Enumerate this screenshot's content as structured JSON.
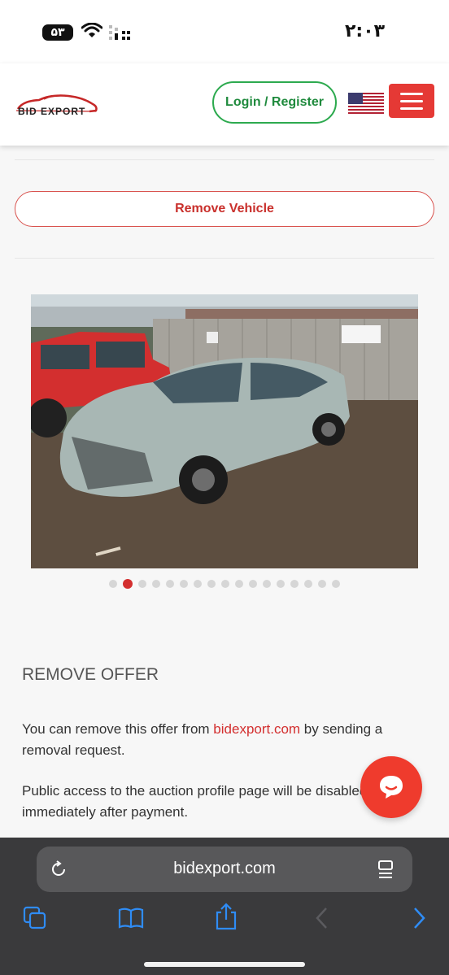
{
  "status_bar": {
    "time": "۲:۰۳",
    "battery": "۵۳"
  },
  "header": {
    "logo_text": "BID EXPORT",
    "login_label": "Login / Register"
  },
  "actions": {
    "remove_vehicle_label": "Remove Vehicle"
  },
  "gallery": {
    "total_images": 17,
    "active_index": 1
  },
  "remove_offer": {
    "title": "REMOVE OFFER",
    "p1_before": "You can remove this offer from ",
    "p1_link": "bidexport.com",
    "p1_after": " by sending a removal request.",
    "p2": "Public access to the auction profile page will be disabled immediately after payment."
  },
  "browser": {
    "url": "bidexport.com"
  },
  "colors": {
    "accent_red": "#e53935",
    "green": "#2daa4f",
    "link": "#d32f2f"
  }
}
